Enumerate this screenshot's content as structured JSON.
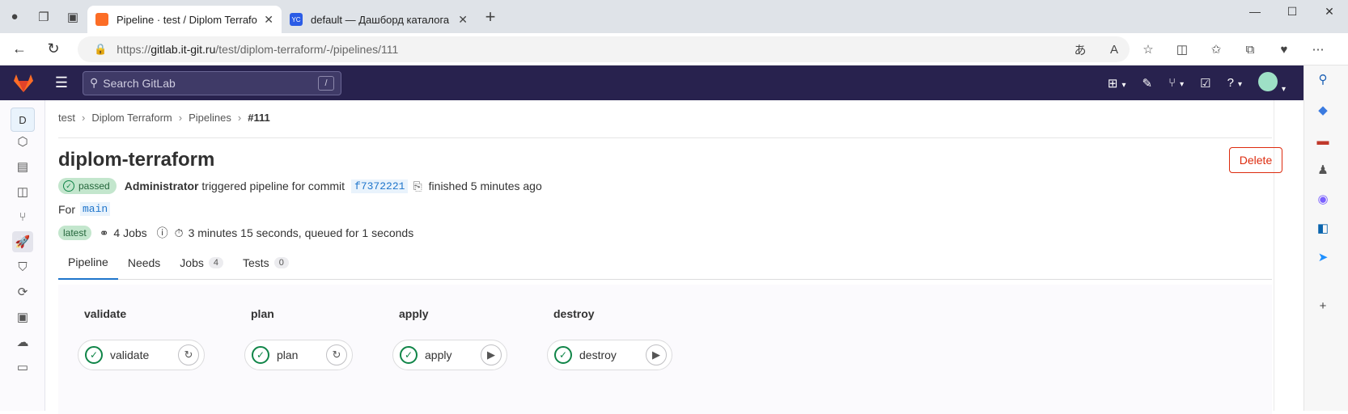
{
  "browser": {
    "tabs": [
      {
        "title": "Pipeline · test / Diplom Terraform",
        "active": true
      },
      {
        "title": "default — Дашборд каталога | Y",
        "active": false
      }
    ],
    "url_prefix": "https://",
    "url_host": "gitlab.it-git.ru",
    "url_path": "/test/diplom-terraform/-/pipelines/111"
  },
  "gitlab": {
    "search_placeholder": "Search GitLab",
    "search_shortcut": "/",
    "project_initial": "D"
  },
  "breadcrumb": [
    "test",
    "Diplom Terraform",
    "Pipelines",
    "#111"
  ],
  "pipeline": {
    "title": "diplom-terraform",
    "delete_label": "Delete",
    "status": "passed",
    "triggered_by": "Administrator",
    "triggered_text": "triggered pipeline for commit",
    "commit": "f7372221",
    "finished": "finished 5 minutes ago",
    "for_label": "For",
    "branch": "main",
    "latest_badge": "latest",
    "jobs_count": "4 Jobs",
    "duration": "3 minutes 15 seconds, queued for 1 seconds"
  },
  "tabs": [
    {
      "label": "Pipeline",
      "count": null
    },
    {
      "label": "Needs",
      "count": null
    },
    {
      "label": "Jobs",
      "count": "4"
    },
    {
      "label": "Tests",
      "count": "0"
    }
  ],
  "stages": [
    {
      "name": "validate",
      "job": "validate",
      "status": "success",
      "action": "retry-icon"
    },
    {
      "name": "plan",
      "job": "plan",
      "status": "success",
      "action": "retry-icon"
    },
    {
      "name": "apply",
      "job": "apply",
      "status": "success",
      "action": "play-icon"
    },
    {
      "name": "destroy",
      "job": "destroy",
      "status": "success",
      "action": "play-icon"
    }
  ],
  "colors": {
    "gitlab_nav": "#28224e",
    "success": "#108548",
    "danger": "#dd2b0e",
    "link": "#1f75cb"
  }
}
